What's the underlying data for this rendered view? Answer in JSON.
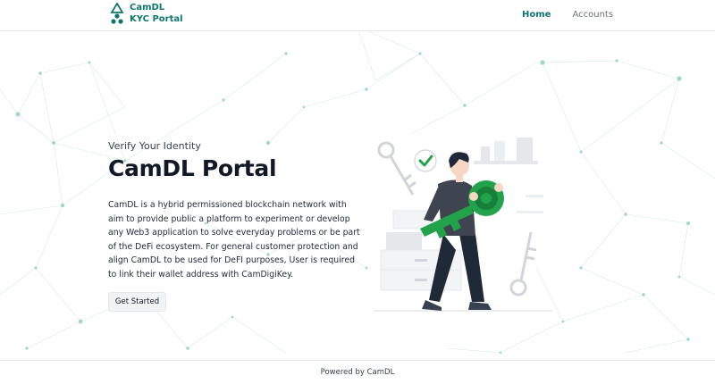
{
  "brand": {
    "line1": "CamDL",
    "line2": "KYC Portal"
  },
  "nav": {
    "home": "Home",
    "accounts": "Accounts"
  },
  "hero": {
    "subtitle": "Verify Your Identity",
    "title": "CamDL Portal",
    "description": "CamDL is a hybrid permissioned blockchain network with aim to provide public a platform to experiment or develop any Web3 application to solve everyday problems or be part of the DeFi ecosystem. For general customer protection and align CamDL to be used for DeFI purposes, User is required to link their wallet address with CamDigiKey.",
    "cta_label": "Get Started"
  },
  "footer": {
    "text": "Powered by CamDL"
  },
  "colors": {
    "brand": "#0f766e",
    "key_green": "#22a34a",
    "network": "#9fd9c8",
    "text_dark": "#111827"
  },
  "icons": [
    "camdl-logo-icon",
    "check-circle-icon",
    "key-icon",
    "skeleton-key-icon",
    "network-background"
  ]
}
